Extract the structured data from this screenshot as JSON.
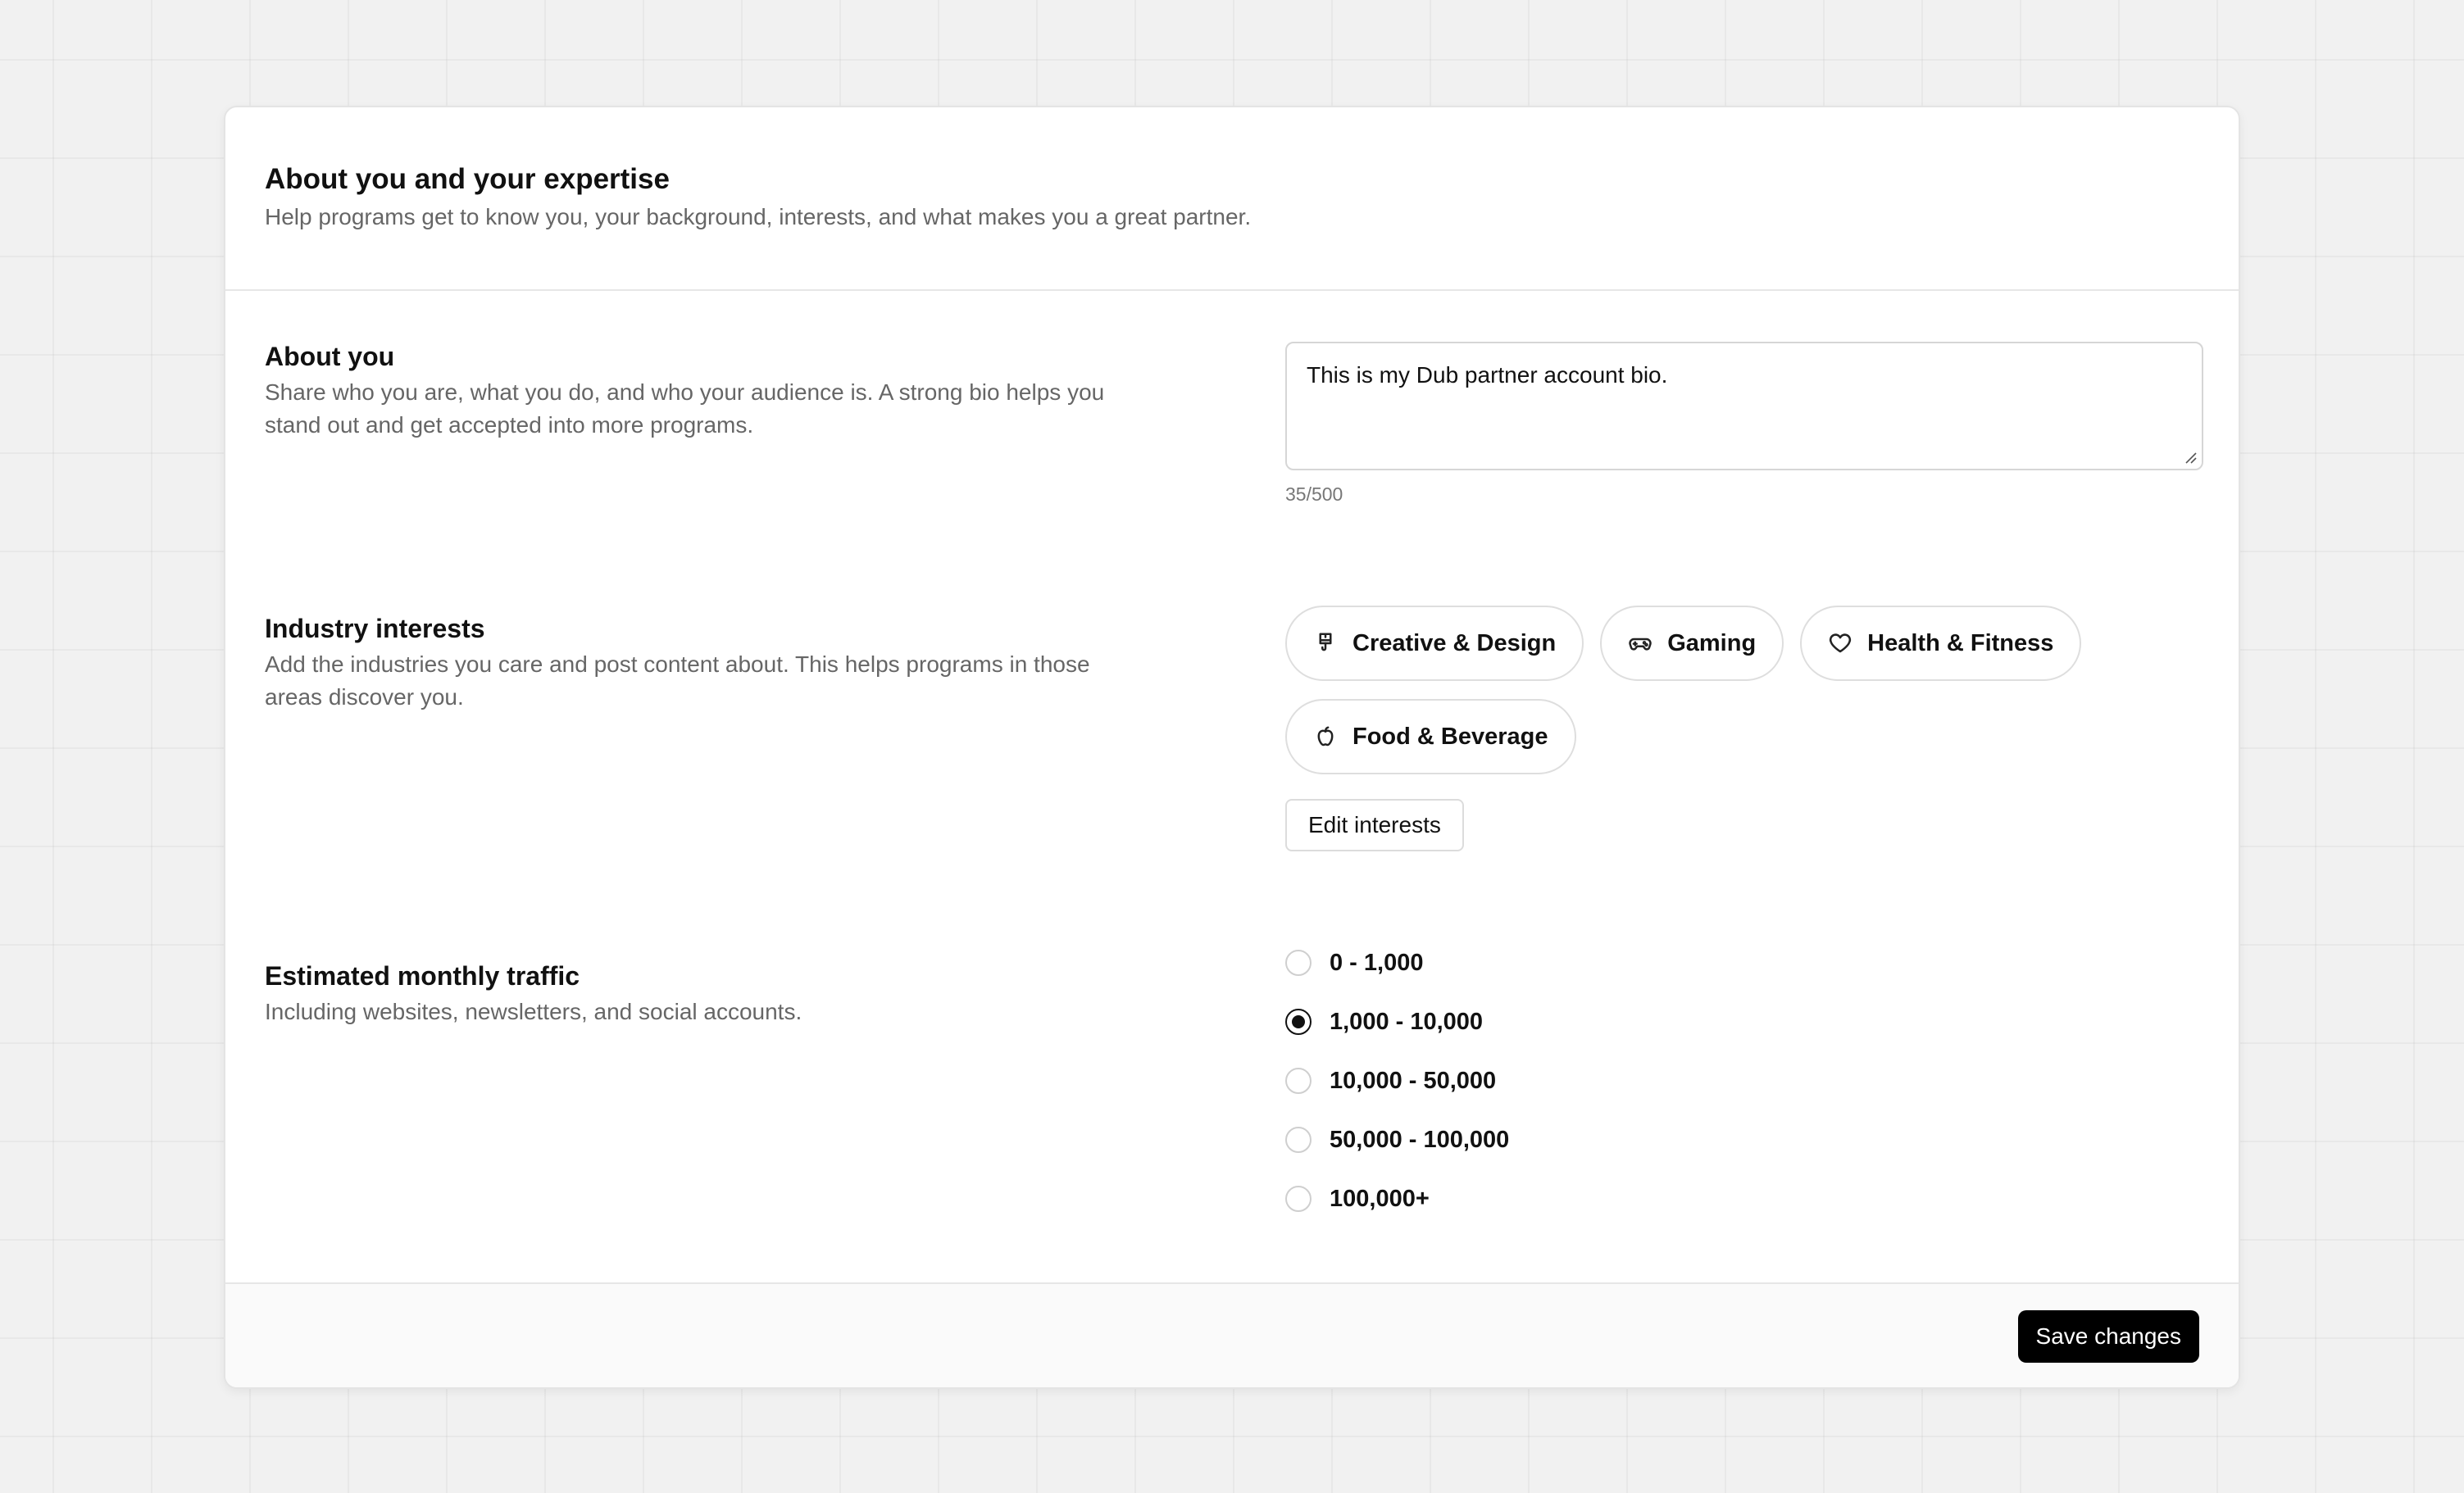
{
  "header": {
    "title": "About you and your expertise",
    "subtitle": "Help programs get to know you, your background, interests, and what makes you a great partner."
  },
  "about": {
    "title": "About you",
    "description": "Share who you are, what you do, and who your audience is. A strong bio helps you stand out and get accepted into more programs.",
    "bio_value": "This is my Dub partner account bio.",
    "char_count": "35/500"
  },
  "interests": {
    "title": "Industry interests",
    "description": "Add the industries you care and post content about. This helps programs in those areas discover you.",
    "chips": [
      {
        "label": "Creative & Design",
        "icon": "paintbrush-icon"
      },
      {
        "label": "Gaming",
        "icon": "gamepad-icon"
      },
      {
        "label": "Health & Fitness",
        "icon": "heart-icon"
      },
      {
        "label": "Food & Beverage",
        "icon": "apple-icon"
      }
    ],
    "edit_label": "Edit interests"
  },
  "traffic": {
    "title": "Estimated monthly traffic",
    "description": "Including websites, newsletters, and social accounts.",
    "options": [
      {
        "label": "0 - 1,000",
        "selected": false
      },
      {
        "label": "1,000 - 10,000",
        "selected": true
      },
      {
        "label": "10,000 - 50,000",
        "selected": false
      },
      {
        "label": "50,000 - 100,000",
        "selected": false
      },
      {
        "label": "100,000+",
        "selected": false
      }
    ]
  },
  "footer": {
    "save_label": "Save changes"
  },
  "colors": {
    "primary_button": "#000000",
    "background": "#f1f1f1",
    "card": "#ffffff"
  }
}
